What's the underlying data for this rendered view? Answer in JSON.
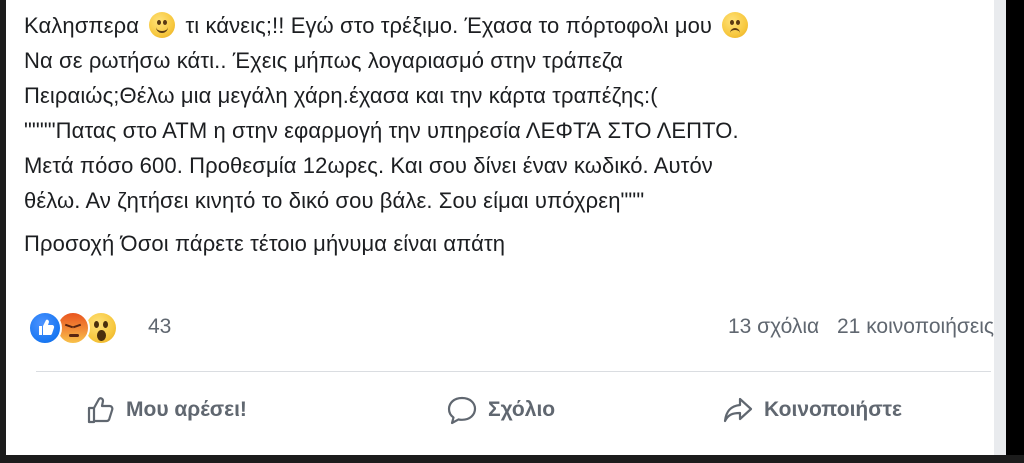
{
  "post": {
    "line1_a": "Καλησπερα",
    "line1_b": "τι κάνεις;!! Εγώ στο τρέξιμο. Έχασα το πόρτοφολι μου",
    "line2": "Να σε ρωτήσω κάτι.. Έχεις μήπως λογαριασμό στην τράπεζα",
    "line3": "Πειραιώς;Θέλω μια μεγάλη χάρη.έχασα και την κάρτα τραπέζης:(",
    "line4": "\"\"\"\"Πατας στο ΑΤΜ η στην εφαρμογή την υπηρεσία ΛΕΦΤΆ ΣΤΟ ΛΕΠΤΟ.",
    "line5": "Μετά πόσο 600. Προθεσμία 12ωρες. Και σου δίνει έναν κωδικό. Αυτόν",
    "line6": "θέλω. Αν ζητήσει κινητό το δικό σου βάλε. Σου είμαι υπόχρεη\"\"\"",
    "warning": "Προσοχή Όσοι πάρετε τέτοιο μήνυμα είναι απάτη",
    "emoji_1": "smiling-face-emoji",
    "emoji_2": "sad-face-emoji"
  },
  "reactions": {
    "icons": [
      "like-reaction-icon",
      "angry-reaction-icon",
      "wow-reaction-icon"
    ],
    "count": "43",
    "comments": "13 σχόλια",
    "shares": "21 κοινοποιήσεις"
  },
  "actions": {
    "like_label": "Μου αρέσει!",
    "comment_label": "Σχόλιο",
    "share_label": "Κοινοποιήστε"
  },
  "colors": {
    "text": "#1c1e21",
    "muted": "#606770",
    "like_blue": "#1877f2",
    "divider": "#dadde1"
  }
}
